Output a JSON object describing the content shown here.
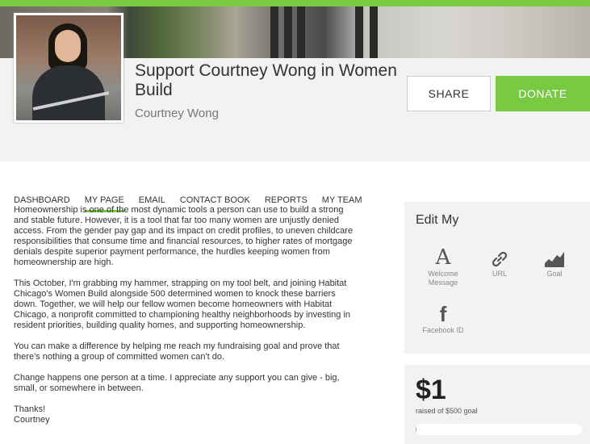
{
  "header": {
    "title": "Support Courtney Wong in Women Build",
    "owner_name": "Courtney Wong",
    "share_label": "SHARE",
    "donate_label": "DONATE"
  },
  "nav": {
    "items": [
      "DASHBOARD",
      "MY PAGE",
      "EMAIL",
      "CONTACT BOOK",
      "REPORTS",
      "MY TEAM"
    ],
    "active": "MY PAGE"
  },
  "story": {
    "paragraphs": [
      "Homeownership is one of the most dynamic tools a person can use to build a strong\nand stable future. However, it is a tool that far too many women are unjustly denied\naccess. From the gender pay gap and its impact on credit profiles, to uneven childcare\nresponsibilities that consume time and financial resources, to higher rates of mortgage\ndenials despite superior payment performance, the hurdles keeping women from\nhomeownership are high.",
      "This October, I'm grabbing my hammer, strapping on my tool belt, and joining Habitat\nChicago's Women Build alongside 500 determined women to knock these barriers\ndown. Together, we will help our fellow women become homeowners with Habitat\nChicago, a nonprofit committed to championing healthy neighborhoods by investing in\nresident priorities, building quality homes, and supporting homeownership.",
      "You can make a difference by helping me reach my fundraising goal and prove that\nthere's nothing a group of committed women can't do.",
      "Change happens one person at a time. I appreciate any support you can give - big,\nsmall, or somewhere in between."
    ],
    "signoff": "Thanks!\nCourtney"
  },
  "edit": {
    "title": "Edit My",
    "welcome_label": "Welcome\nMessage",
    "url_label": "URL",
    "goal_label": "Goal",
    "facebook_label": "Facebook ID",
    "welcome_glyph": "A",
    "facebook_glyph": "f"
  },
  "fundraising": {
    "amount": "$1",
    "raised_text": "raised of $500 goal",
    "progress_fraction": 0.002
  },
  "colors": {
    "accent": "#7ac943",
    "panel": "#f2f2f2"
  },
  "icons": [
    "welcome-message-icon",
    "link-icon",
    "goal-chart-icon",
    "facebook-icon"
  ]
}
